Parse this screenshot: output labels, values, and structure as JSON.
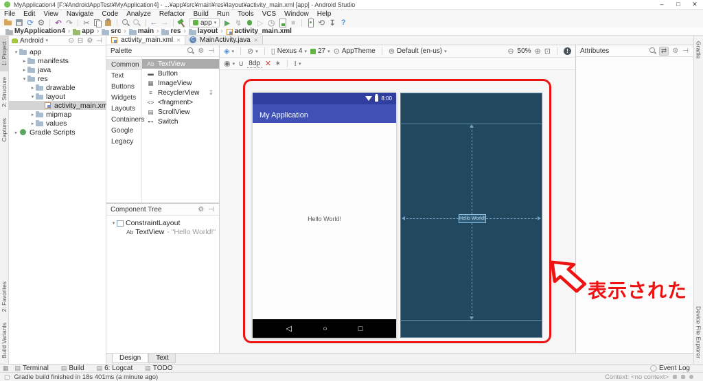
{
  "window": {
    "title": "MyApplication4 [F:¥AndroidAppTest¥MyApplication4] - ...¥app¥src¥main¥res¥layout¥activity_main.xml [app] - Android Studio",
    "minimize": "–",
    "maximize": "□",
    "close": "✕"
  },
  "menu": {
    "items": [
      "File",
      "Edit",
      "View",
      "Navigate",
      "Code",
      "Analyze",
      "Refactor",
      "Build",
      "Run",
      "Tools",
      "VCS",
      "Window",
      "Help"
    ]
  },
  "toolbar": {
    "run_config_label": "app",
    "icons": [
      "open-folder",
      "save-all",
      "sync",
      "settings",
      "|",
      "undo",
      "redo",
      "|",
      "cut",
      "copy",
      "paste",
      "|",
      "find",
      "replace",
      "|",
      "back",
      "forward",
      "|",
      "make-project",
      "run-config",
      "run",
      "apply-changes",
      "debug",
      "attach-debugger",
      "profiler",
      "coverage",
      "stop",
      "|",
      "avd-manager",
      "gradle-sync",
      "sdk-manager",
      "help"
    ]
  },
  "breadcrumb": {
    "items": [
      {
        "label": "MyApplication4",
        "icon": "project-folder"
      },
      {
        "label": "app",
        "icon": "module-folder"
      },
      {
        "label": "src",
        "icon": "folder"
      },
      {
        "label": "main",
        "icon": "folder"
      },
      {
        "label": "res",
        "icon": "folder"
      },
      {
        "label": "layout",
        "icon": "folder"
      },
      {
        "label": "activity_main.xml",
        "icon": "layout-file"
      }
    ]
  },
  "left_stripe": {
    "top": [
      {
        "label": "1: Project",
        "active": true
      },
      {
        "label": "2: Structure",
        "active": false
      },
      {
        "label": "Captures",
        "active": false
      }
    ],
    "bottom": [
      {
        "label": "2: Favorites",
        "active": false
      },
      {
        "label": "Build Variants",
        "active": false
      }
    ]
  },
  "right_stripe": {
    "top": [
      {
        "label": "Gradle",
        "active": false
      }
    ],
    "bottom": [
      {
        "label": "Device File Explorer",
        "active": false
      }
    ]
  },
  "project_panel": {
    "view": "Android",
    "tree": [
      {
        "label": "app",
        "depth": 0,
        "chevron": "expanded",
        "icon": "folder",
        "selected": false
      },
      {
        "label": "manifests",
        "depth": 1,
        "chevron": "collapsed",
        "icon": "folder",
        "selected": false
      },
      {
        "label": "java",
        "depth": 1,
        "chevron": "collapsed",
        "icon": "folder",
        "selected": false
      },
      {
        "label": "res",
        "depth": 1,
        "chevron": "expanded",
        "icon": "folder",
        "selected": false
      },
      {
        "label": "drawable",
        "depth": 2,
        "chevron": "collapsed",
        "icon": "folder",
        "selected": false
      },
      {
        "label": "layout",
        "depth": 2,
        "chevron": "expanded",
        "icon": "folder",
        "selected": false
      },
      {
        "label": "activity_main.xml",
        "depth": 3,
        "chevron": "none",
        "icon": "layout-file",
        "selected": true
      },
      {
        "label": "mipmap",
        "depth": 2,
        "chevron": "collapsed",
        "icon": "folder",
        "selected": false
      },
      {
        "label": "values",
        "depth": 2,
        "chevron": "collapsed",
        "icon": "folder",
        "selected": false
      },
      {
        "label": "Gradle Scripts",
        "depth": 0,
        "chevron": "collapsed",
        "icon": "gradle",
        "selected": false
      }
    ]
  },
  "editor_tabs": [
    {
      "label": "activity_main.xml",
      "icon": "layout-file",
      "selected": true
    },
    {
      "label": "MainActivity.java",
      "icon": "class",
      "selected": false
    }
  ],
  "palette": {
    "title": "Palette",
    "categories": [
      {
        "label": "Common",
        "selected": true
      },
      {
        "label": "Text",
        "selected": false
      },
      {
        "label": "Buttons",
        "selected": false
      },
      {
        "label": "Widgets",
        "selected": false
      },
      {
        "label": "Layouts",
        "selected": false
      },
      {
        "label": "Containers",
        "selected": false
      },
      {
        "label": "Google",
        "selected": false
      },
      {
        "label": "Legacy",
        "selected": false
      }
    ],
    "items": [
      {
        "glyph": "Ab",
        "label": "TextView",
        "selected": true,
        "download": false
      },
      {
        "glyph": "▬",
        "label": "Button",
        "selected": false,
        "download": false
      },
      {
        "glyph": "▦",
        "label": "ImageView",
        "selected": false,
        "download": false
      },
      {
        "glyph": "≡",
        "label": "RecyclerView",
        "selected": false,
        "download": true
      },
      {
        "glyph": "<>",
        "label": "<fragment>",
        "selected": false,
        "download": false
      },
      {
        "glyph": "▤",
        "label": "ScrollView",
        "selected": false,
        "download": false
      },
      {
        "glyph": "⊷",
        "label": "Switch",
        "selected": false,
        "download": false
      }
    ]
  },
  "component_tree": {
    "title": "Component Tree",
    "rows": [
      {
        "chevron": "expanded",
        "icon": "constraint-layout",
        "glyph": "",
        "label": "ConstraintLayout",
        "detail": ""
      },
      {
        "chevron": "none",
        "icon": "textview",
        "glyph": "Ab",
        "label": "TextView",
        "detail": "- \"Hello World!\""
      }
    ]
  },
  "design_toolbar": {
    "device": "Nexus 4",
    "api_level": "27",
    "theme": "AppTheme",
    "locale": "Default (en-us)",
    "zoom_percent": "50%",
    "default_margin": "8dp"
  },
  "attributes_panel": {
    "title": "Attributes"
  },
  "device_preview": {
    "status_time": "8:00",
    "app_bar_title": "My Application",
    "hello_text": "Hello World!",
    "blueprint_label": "Hello World!"
  },
  "mode_tabs": [
    {
      "label": "Design",
      "selected": true
    },
    {
      "label": "Text",
      "selected": false
    }
  ],
  "bottom_bar": {
    "left": [
      {
        "label": "Terminal",
        "icon": "terminal"
      },
      {
        "label": "Build",
        "icon": "build"
      },
      {
        "label": "6: Logcat",
        "icon": "logcat"
      },
      {
        "label": "TODO",
        "icon": "todo"
      }
    ],
    "right": [
      {
        "label": "Event Log",
        "icon": "event-log"
      }
    ]
  },
  "status_bar": {
    "message": "Gradle build finished in 18s 401ms (a minute ago)",
    "context": "Context: <no context>"
  },
  "annotation": {
    "label": "表示された",
    "color": "#EE1212"
  },
  "colors": {
    "accent_indigo": "#3F51B5",
    "status_bar_indigo": "#303F9F",
    "blueprint_bg": "#21485F",
    "annotation_red": "#EE1212",
    "selection_gray": "#D4D4D4"
  }
}
